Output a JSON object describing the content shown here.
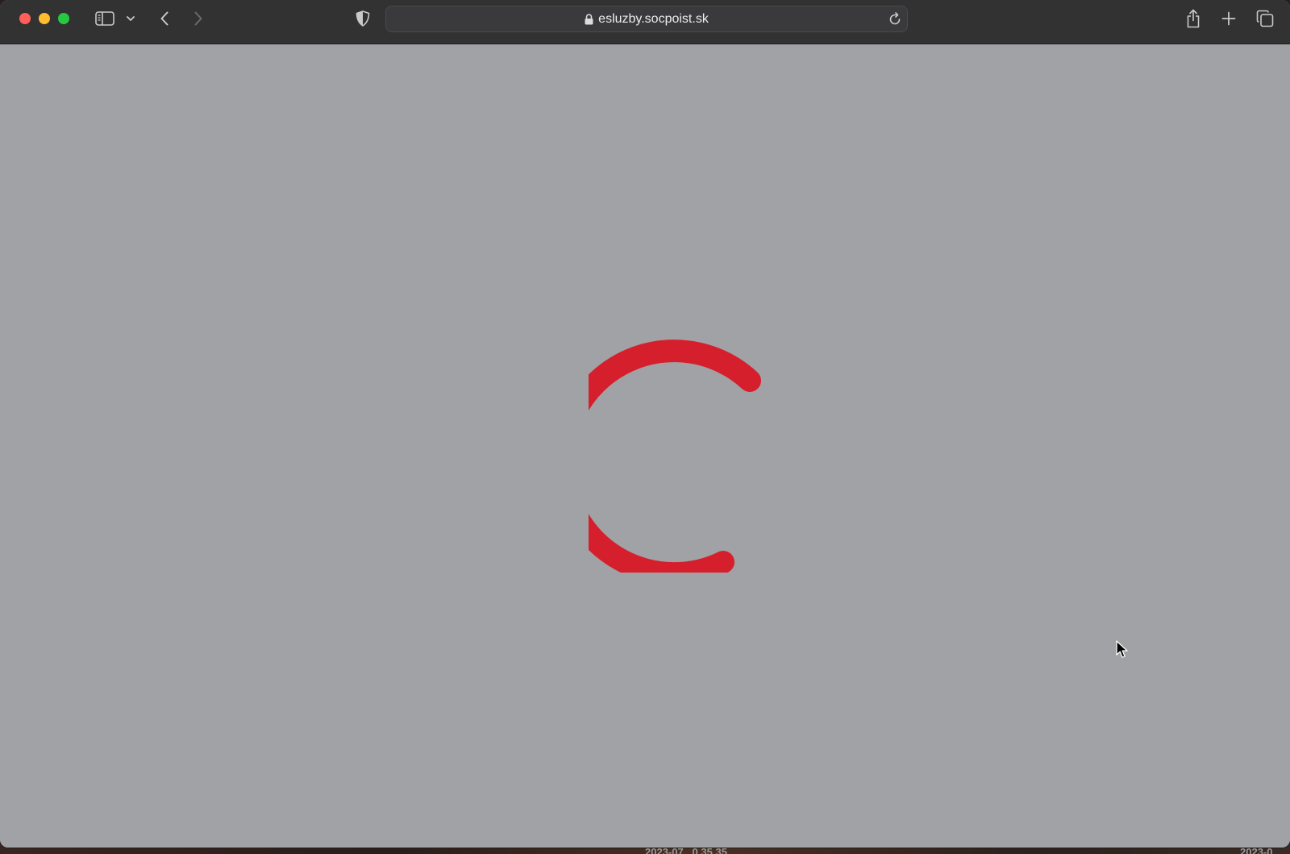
{
  "browser": {
    "url": "esluzby.socpoist.sk",
    "icons": {
      "close": "close-window-button",
      "minimize": "minimize-window-button",
      "maximize": "maximize-window-button",
      "sidebar": "sidebar-icon",
      "sidebar_menu": "chevron-down-icon",
      "back": "back-arrow-icon",
      "forward": "forward-arrow-icon",
      "privacy": "shield-icon",
      "lock": "lock-icon",
      "reload": "reload-icon",
      "share": "share-icon",
      "new_tab": "plus-icon",
      "tabs": "tab-overview-icon"
    }
  },
  "page": {
    "state": "loading",
    "spinner_color": "#d61f2c",
    "background_color": "#a1a2a6"
  },
  "desktop": {
    "labels": [
      "2023-07...0.35.35",
      "2023-0..."
    ]
  }
}
